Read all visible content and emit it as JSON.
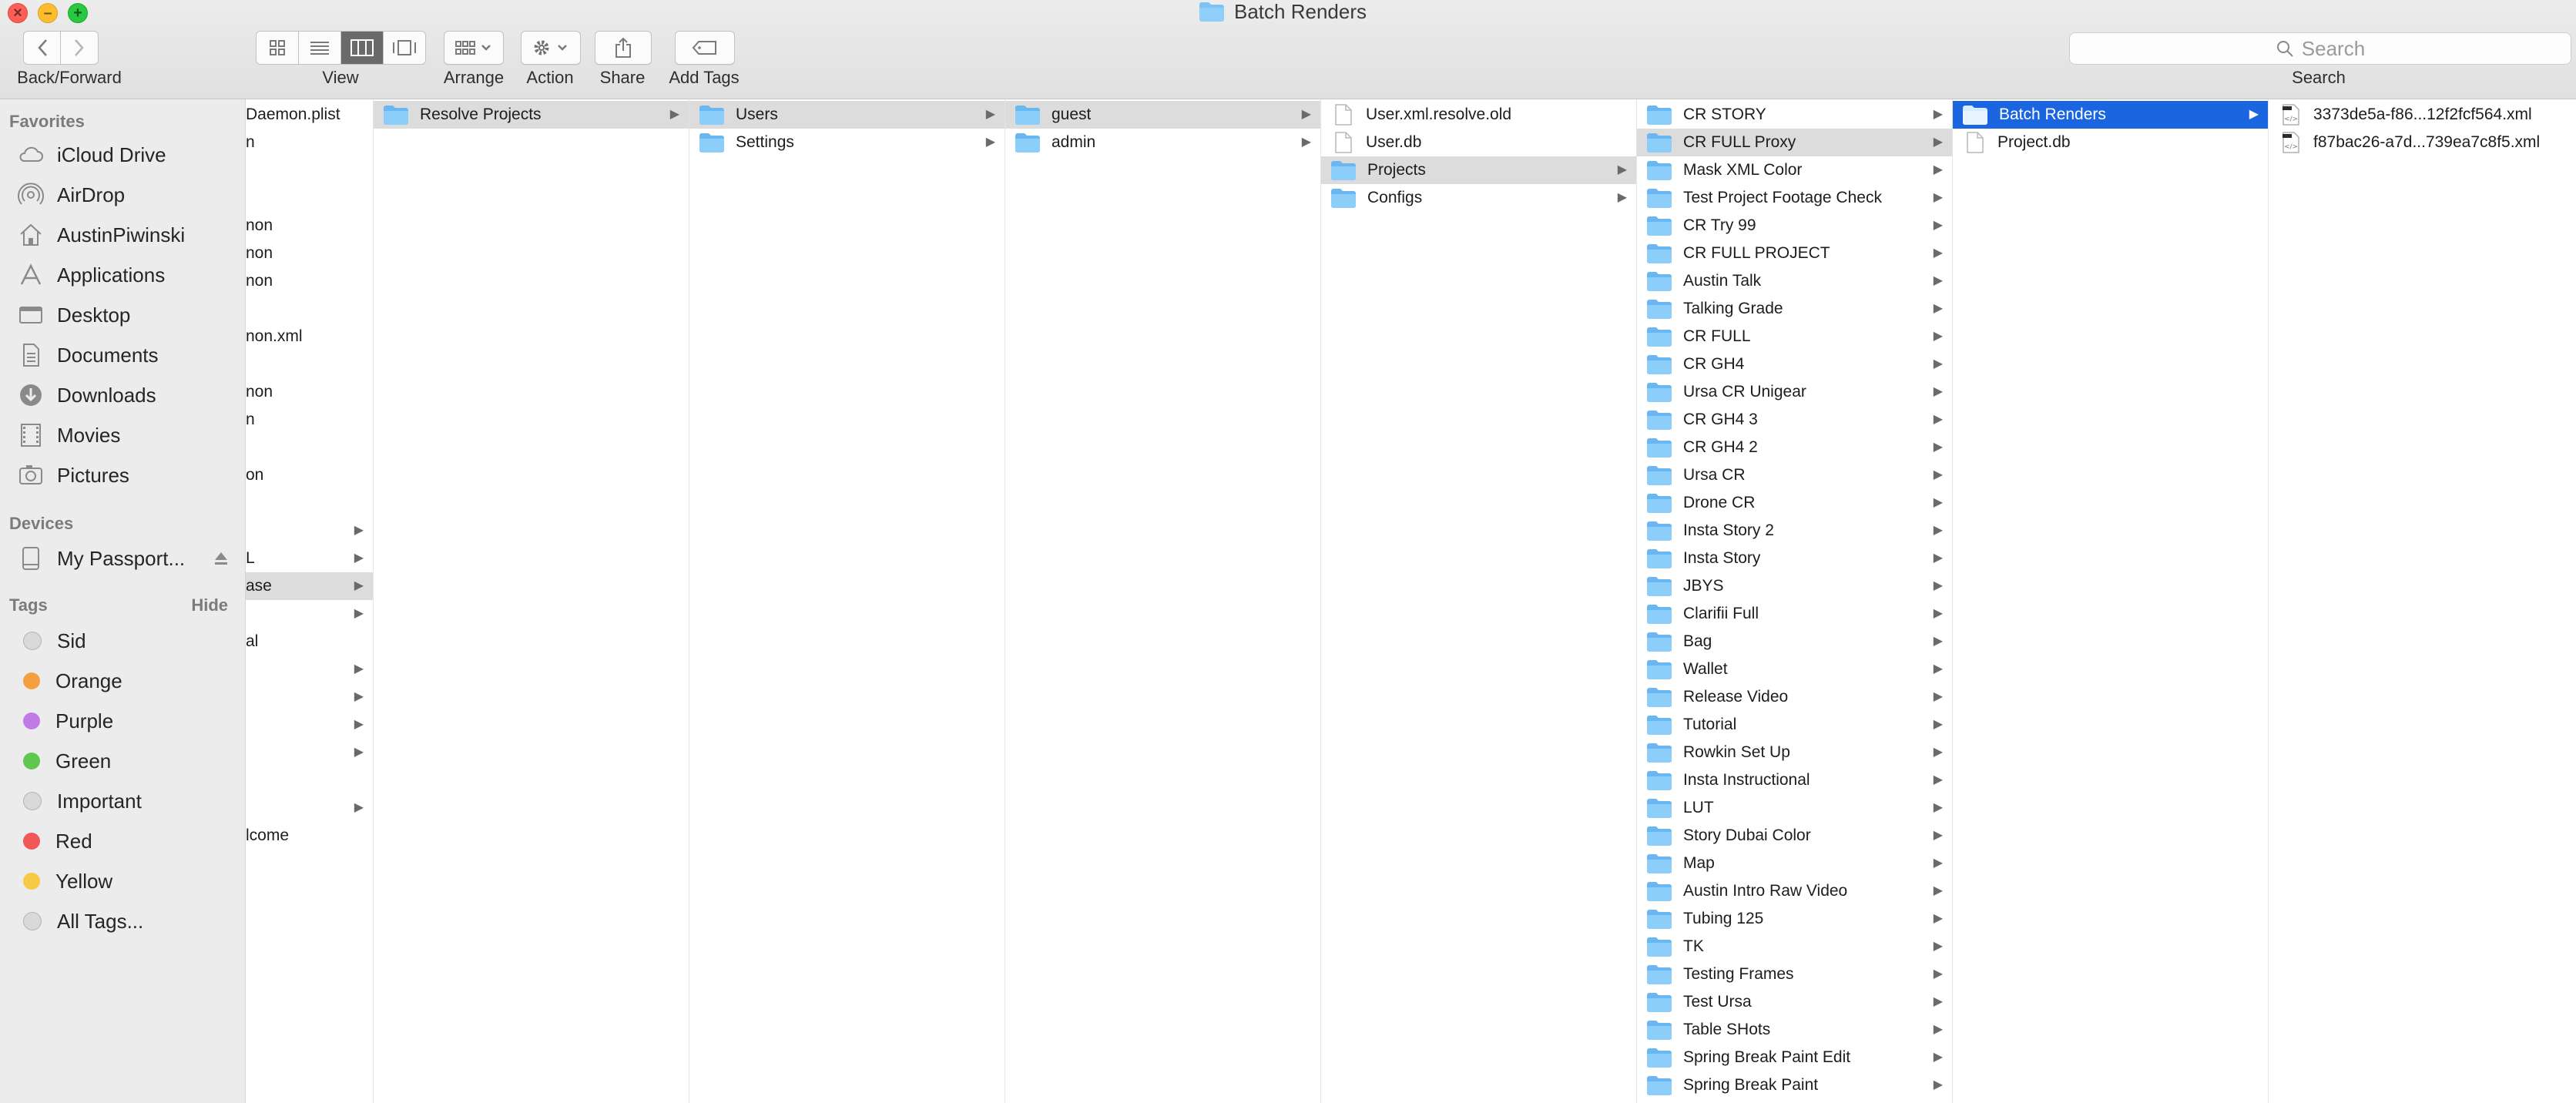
{
  "window": {
    "title": "Batch Renders"
  },
  "toolbar": {
    "back_forward_label": "Back/Forward",
    "view_label": "View",
    "arrange_label": "Arrange",
    "action_label": "Action",
    "share_label": "Share",
    "add_tags_label": "Add Tags",
    "search_placeholder": "Search",
    "search_label": "Search"
  },
  "sidebar": {
    "favorites_header": "Favorites",
    "favorites": [
      {
        "label": "iCloud Drive",
        "icon": "cloud-icon"
      },
      {
        "label": "AirDrop",
        "icon": "airdrop-icon"
      },
      {
        "label": "AustinPiwinski",
        "icon": "home-icon"
      },
      {
        "label": "Applications",
        "icon": "applications-icon"
      },
      {
        "label": "Desktop",
        "icon": "desktop-icon"
      },
      {
        "label": "Documents",
        "icon": "documents-icon"
      },
      {
        "label": "Downloads",
        "icon": "downloads-icon"
      },
      {
        "label": "Movies",
        "icon": "movies-icon"
      },
      {
        "label": "Pictures",
        "icon": "pictures-icon"
      }
    ],
    "devices_header": "Devices",
    "devices": [
      {
        "label": "My Passport...",
        "icon": "drive-icon"
      }
    ],
    "tags_header": "Tags",
    "tags_hide": "Hide",
    "tags": [
      {
        "label": "Sid",
        "color": "#d9d9d9"
      },
      {
        "label": "Orange",
        "color": "#f5a040"
      },
      {
        "label": "Purple",
        "color": "#c17be6"
      },
      {
        "label": "Green",
        "color": "#5fc74d"
      },
      {
        "label": "Important",
        "color": "#d9d9d9"
      },
      {
        "label": "Red",
        "color": "#f25656"
      },
      {
        "label": "Yellow",
        "color": "#f7c945"
      },
      {
        "label": "All Tags...",
        "color": "#d9d9d9"
      }
    ]
  },
  "columns": {
    "col0": [
      {
        "text": "Daemon.plist",
        "arrow": false
      },
      {
        "text": "n",
        "arrow": false
      },
      {
        "text": "",
        "arrow": false
      },
      {
        "text": "",
        "arrow": false
      },
      {
        "text": "non",
        "arrow": false
      },
      {
        "text": "non",
        "arrow": false
      },
      {
        "text": "non",
        "arrow": false
      },
      {
        "text": "",
        "arrow": false
      },
      {
        "text": "non.xml",
        "arrow": false
      },
      {
        "text": "",
        "arrow": false
      },
      {
        "text": "non",
        "arrow": false
      },
      {
        "text": "n",
        "arrow": false
      },
      {
        "text": "",
        "arrow": false
      },
      {
        "text": "on",
        "arrow": false
      },
      {
        "text": "",
        "arrow": false
      },
      {
        "text": "",
        "arrow": true
      },
      {
        "text": "L",
        "arrow": true
      },
      {
        "text": "ase",
        "arrow": true,
        "selected": true
      },
      {
        "text": "",
        "arrow": true
      },
      {
        "text": "al",
        "arrow": false
      },
      {
        "text": "",
        "arrow": true
      },
      {
        "text": "",
        "arrow": true
      },
      {
        "text": "",
        "arrow": true
      },
      {
        "text": "",
        "arrow": true
      },
      {
        "text": "",
        "arrow": false
      },
      {
        "text": "",
        "arrow": true
      },
      {
        "text": "lcome",
        "arrow": false
      }
    ],
    "col1": [
      {
        "text": "Resolve Projects",
        "selected": true
      }
    ],
    "col2": [
      {
        "text": "Users",
        "selected": true
      },
      {
        "text": "Settings"
      }
    ],
    "col3": [
      {
        "text": "guest",
        "selected": true
      },
      {
        "text": "admin"
      }
    ],
    "col4": [
      {
        "text": "User.xml.resolve.old",
        "type": "file"
      },
      {
        "text": "User.db",
        "type": "file"
      },
      {
        "text": "Projects",
        "type": "folder",
        "selected": true
      },
      {
        "text": "Configs",
        "type": "folder"
      }
    ],
    "col5": [
      "CR STORY",
      "CR FULL Proxy",
      "Mask XML Color",
      "Test Project Footage Check",
      "CR Try 99",
      "CR FULL PROJECT",
      "Austin Talk",
      "Talking Grade",
      "CR FULL",
      "CR GH4",
      "Ursa CR Unigear",
      "CR GH4 3",
      "CR GH4 2",
      "Ursa CR",
      "Drone CR",
      "Insta Story 2",
      "Insta Story",
      "JBYS",
      "Clarifii Full",
      "Bag",
      "Wallet",
      "Release Video",
      "Tutorial",
      "Rowkin Set Up",
      "Insta Instructional",
      "LUT",
      "Story Dubai Color",
      "Map",
      "Austin Intro Raw Video",
      "Tubing 125",
      "TK",
      "Testing Frames",
      "Test Ursa",
      "Table SHots",
      "Spring Break Paint Edit",
      "Spring Break Paint"
    ],
    "col5_selected": "CR FULL Proxy",
    "col6": [
      {
        "text": "Batch Renders",
        "type": "folder",
        "selected": true
      },
      {
        "text": "Project.db",
        "type": "file"
      }
    ],
    "col7": [
      {
        "text": "3373de5a-f86...12f2fcf564.xml"
      },
      {
        "text": "f87bac26-a7d...739ea7c8f5.xml"
      }
    ]
  }
}
